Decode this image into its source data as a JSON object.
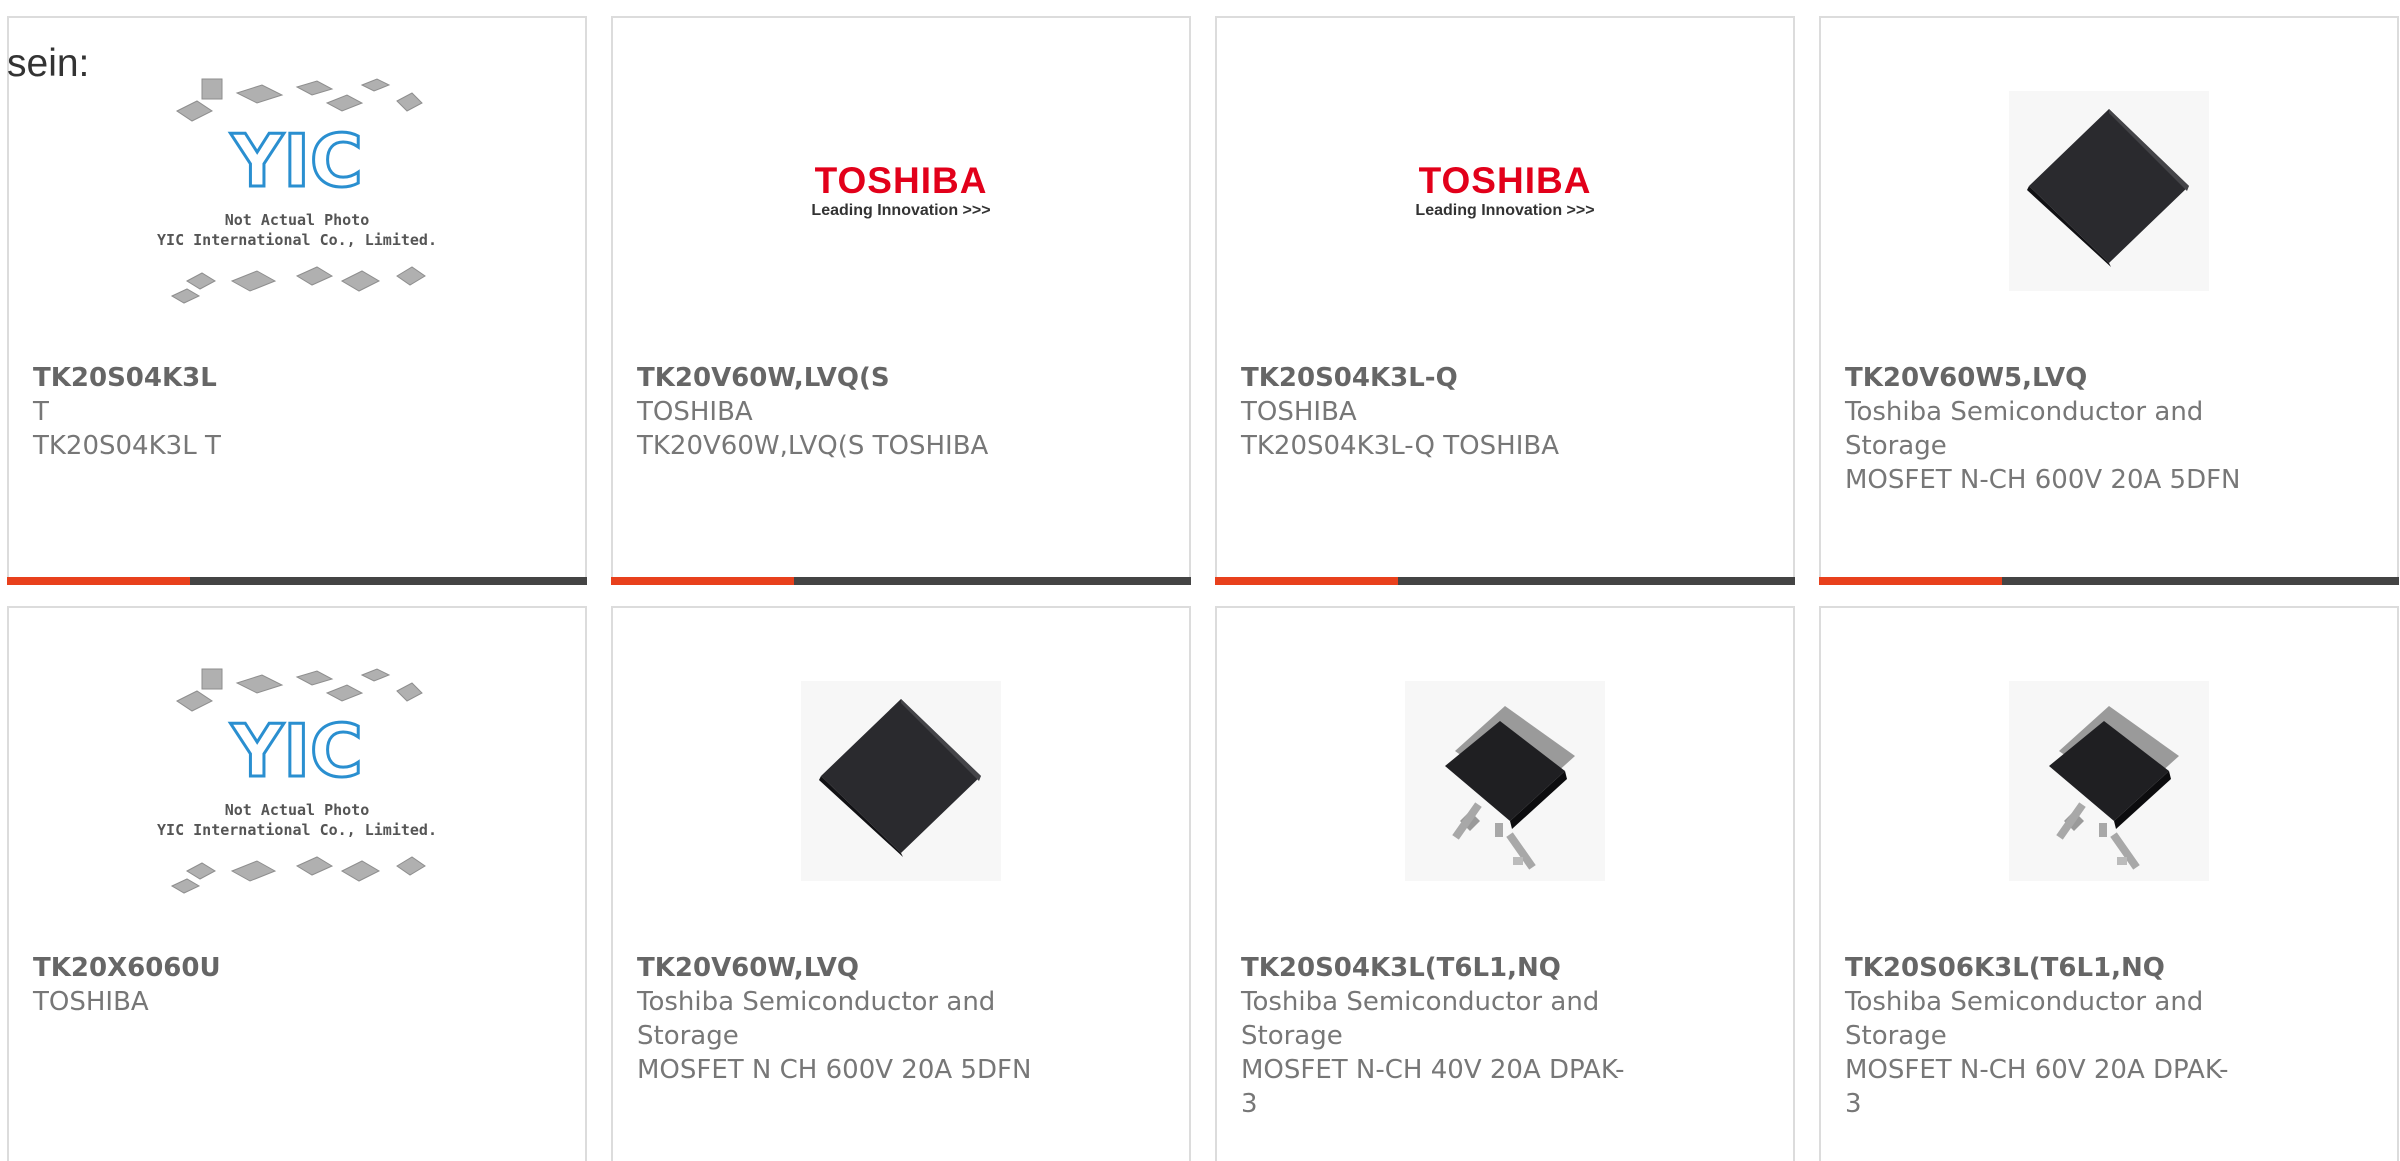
{
  "intro_text": "sein:",
  "colors": {
    "accent": "#e8401c",
    "bar": "#444444",
    "toshiba_red": "#e2001a",
    "yic_blue": "#2a8fd0"
  },
  "placeholder": {
    "logo": "YIC",
    "caption_line1": "Not Actual Photo",
    "caption_line2": "YIC International Co., Limited."
  },
  "toshiba_logo": {
    "brand": "TOSHIBA",
    "tagline": "Leading Innovation >>>"
  },
  "products": [
    {
      "title": "TK20S04K3L",
      "lines": [
        "T",
        "TK20S04K3L T"
      ],
      "image": "yic-placeholder"
    },
    {
      "title": "TK20V60W,LVQ(S",
      "lines": [
        "TOSHIBA",
        "TK20V60W,LVQ(S TOSHIBA"
      ],
      "image": "toshiba-logo"
    },
    {
      "title": "TK20S04K3L-Q",
      "lines": [
        "TOSHIBA",
        "TK20S04K3L-Q TOSHIBA"
      ],
      "image": "toshiba-logo"
    },
    {
      "title": "TK20V60W5,LVQ",
      "lines": [
        "Toshiba Semiconductor and Storage",
        "MOSFET N-CH 600V 20A 5DFN"
      ],
      "image": "dfn-package"
    },
    {
      "title": "TK20X6060U",
      "lines": [
        "TOSHIBA"
      ],
      "image": "yic-placeholder"
    },
    {
      "title": "TK20V60W,LVQ",
      "lines": [
        "Toshiba Semiconductor and Storage",
        "MOSFET N CH 600V 20A 5DFN"
      ],
      "image": "dfn-package"
    },
    {
      "title": "TK20S04K3L(T6L1,NQ",
      "lines": [
        "Toshiba Semiconductor and Storage",
        "MOSFET N-CH 40V 20A DPAK-3"
      ],
      "image": "dpak-package"
    },
    {
      "title": "TK20S06K3L(T6L1,NQ",
      "lines": [
        "Toshiba Semiconductor and Storage",
        "MOSFET N-CH 60V 20A DPAK-3"
      ],
      "image": "dpak-package"
    }
  ]
}
